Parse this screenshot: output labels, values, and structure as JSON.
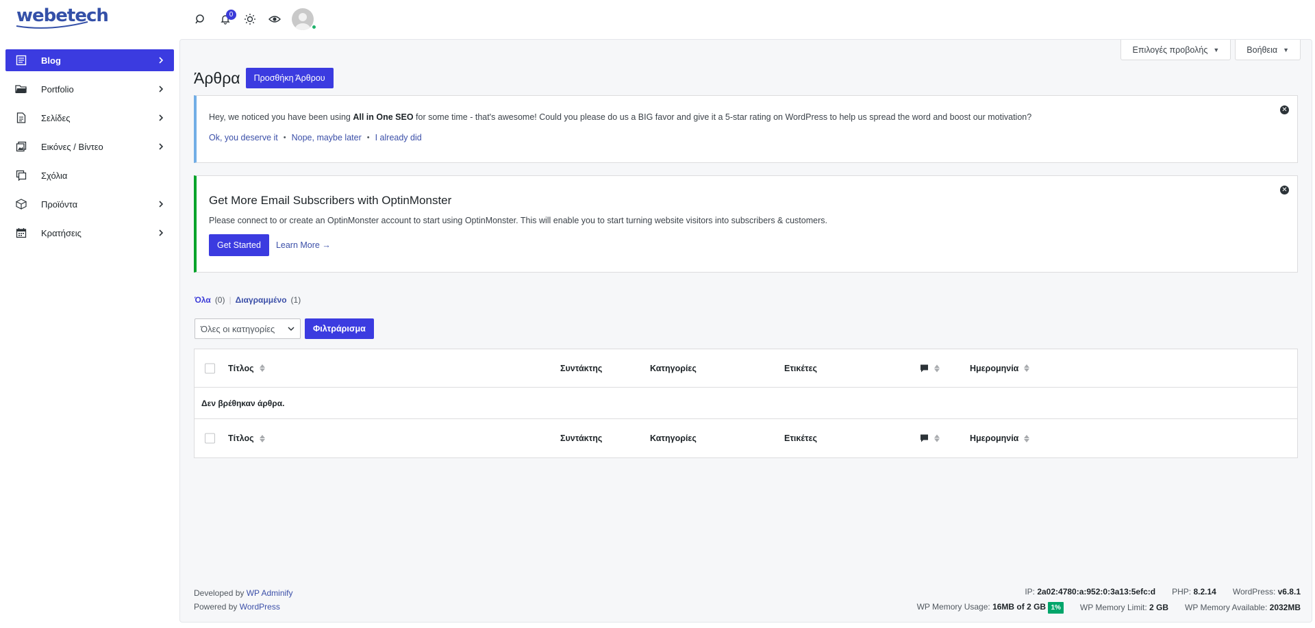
{
  "brand": {
    "logo_text": "webetech"
  },
  "topbar": {
    "notifications_count": "0"
  },
  "sidebar": {
    "items": [
      {
        "label": "Blog",
        "icon": "blog-icon",
        "active": true,
        "has_submenu": true
      },
      {
        "label": "Portfolio",
        "icon": "folder-icon",
        "active": false,
        "has_submenu": true
      },
      {
        "label": "Σελίδες",
        "icon": "page-icon",
        "active": false,
        "has_submenu": true
      },
      {
        "label": "Εικόνες / Βίντεο",
        "icon": "media-icon",
        "active": false,
        "has_submenu": true
      },
      {
        "label": "Σχόλια",
        "icon": "comments-icon",
        "active": false,
        "has_submenu": false
      },
      {
        "label": "Προϊόντα",
        "icon": "box-icon",
        "active": false,
        "has_submenu": true
      },
      {
        "label": "Κρατήσεις",
        "icon": "calendar-icon",
        "active": false,
        "has_submenu": true
      }
    ]
  },
  "screen": {
    "options_label": "Επιλογές προβολής",
    "help_label": "Βοήθεια"
  },
  "page": {
    "title": "Άρθρα",
    "add_new_label": "Προσθήκη Άρθρου"
  },
  "seo_notice": {
    "text_before": "Hey, we noticed you have been using ",
    "text_bold": "All in One SEO",
    "text_after": " for some time - that's awesome! Could you please do us a BIG favor and give it a 5-star rating on WordPress to help us spread the word and boost our motivation?",
    "link_yes": "Ok, you deserve it",
    "link_later": "Nope, maybe later",
    "link_did": "I already did"
  },
  "om_notice": {
    "title": "Get More Email Subscribers with OptinMonster",
    "text": "Please connect to or create an OptinMonster account to start using OptinMonster. This will enable you to start turning website visitors into subscribers & customers.",
    "button": "Get Started",
    "learn_more": "Learn More →"
  },
  "views": {
    "all_label": "Όλα",
    "all_count": "(0)",
    "trash_label": "Διαγραμμένο",
    "trash_count": "(1)"
  },
  "filters": {
    "category_selected": "Όλες οι κατηγορίες",
    "filter_button": "Φιλτράρισμα"
  },
  "table": {
    "columns": {
      "title": "Τίτλος",
      "author": "Συντάκτης",
      "categories": "Κατηγορίες",
      "tags": "Ετικέτες",
      "date": "Ημερομηνία"
    },
    "empty_message": "Δεν βρέθηκαν άρθρα."
  },
  "footer": {
    "developed_by": "Developed by ",
    "developed_link": "WP Adminify",
    "powered_by": "Powered by ",
    "powered_link": "WordPress",
    "ip_label": "IP: ",
    "ip_value": "2a02:4780:a:952:0:3a13:5efc:d",
    "php_label": "PHP: ",
    "php_value": "8.2.14",
    "wp_label": "WordPress: ",
    "wp_value": "v6.8.1",
    "mem_usage_label": "WP Memory Usage: ",
    "mem_usage_value": "16MB of 2 GB",
    "mem_usage_pct": "1%",
    "mem_limit_label": "WP Memory Limit: ",
    "mem_limit_value": "2 GB",
    "mem_avail_label": "WP Memory Available: ",
    "mem_avail_value": "2032MB"
  },
  "colors": {
    "primary": "#3b3be0",
    "seo_border": "#72aee6",
    "om_border": "#00a32a",
    "usage_badge": "#00a56a"
  }
}
